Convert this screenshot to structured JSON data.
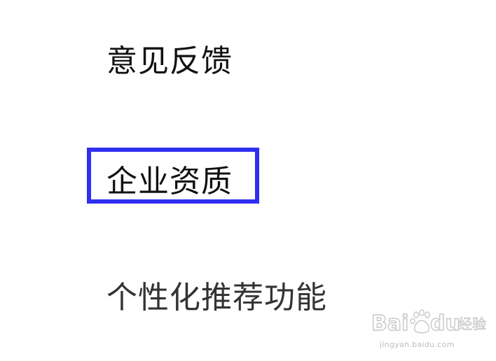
{
  "menu": {
    "items": [
      {
        "label": "意见反馈"
      },
      {
        "label": "企业资质"
      },
      {
        "label": "个性化推荐功能"
      }
    ],
    "highlight_color": "#2f2ff0"
  },
  "watermark": {
    "logo_text": "Baidu经验",
    "url": "jingyan.baidu.com"
  }
}
